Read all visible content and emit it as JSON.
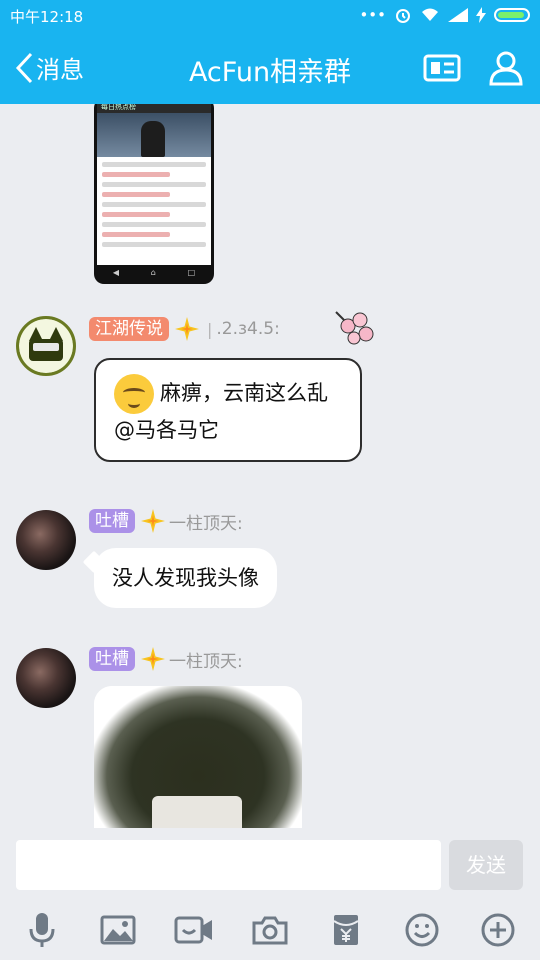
{
  "status": {
    "time": "中午12:18"
  },
  "nav": {
    "back_label": "消息",
    "title": "AcFun相亲群"
  },
  "messages": [
    {
      "badge": "江湖传说",
      "sep": "|",
      "nickname": ".2.з4.5:",
      "text": "麻痹，云南这么乱",
      "mention": "@马各马它"
    },
    {
      "badge": "吐槽",
      "nickname": "一柱顶天:",
      "text": "没人发现我头像"
    },
    {
      "badge": "吐槽",
      "nickname": "一柱顶天:"
    }
  ],
  "phone_screenshot": {
    "header": "每日热点榜"
  },
  "input": {
    "send_label": "发送",
    "placeholder": ""
  },
  "colors": {
    "accent": "#19b4f0",
    "badge_orange": "#f38a6e",
    "badge_purple": "#ab91e8"
  },
  "toolbar_icons": [
    "microphone-icon",
    "image-icon",
    "video-icon",
    "camera-icon",
    "red-packet-icon",
    "emoji-icon",
    "plus-icon"
  ]
}
